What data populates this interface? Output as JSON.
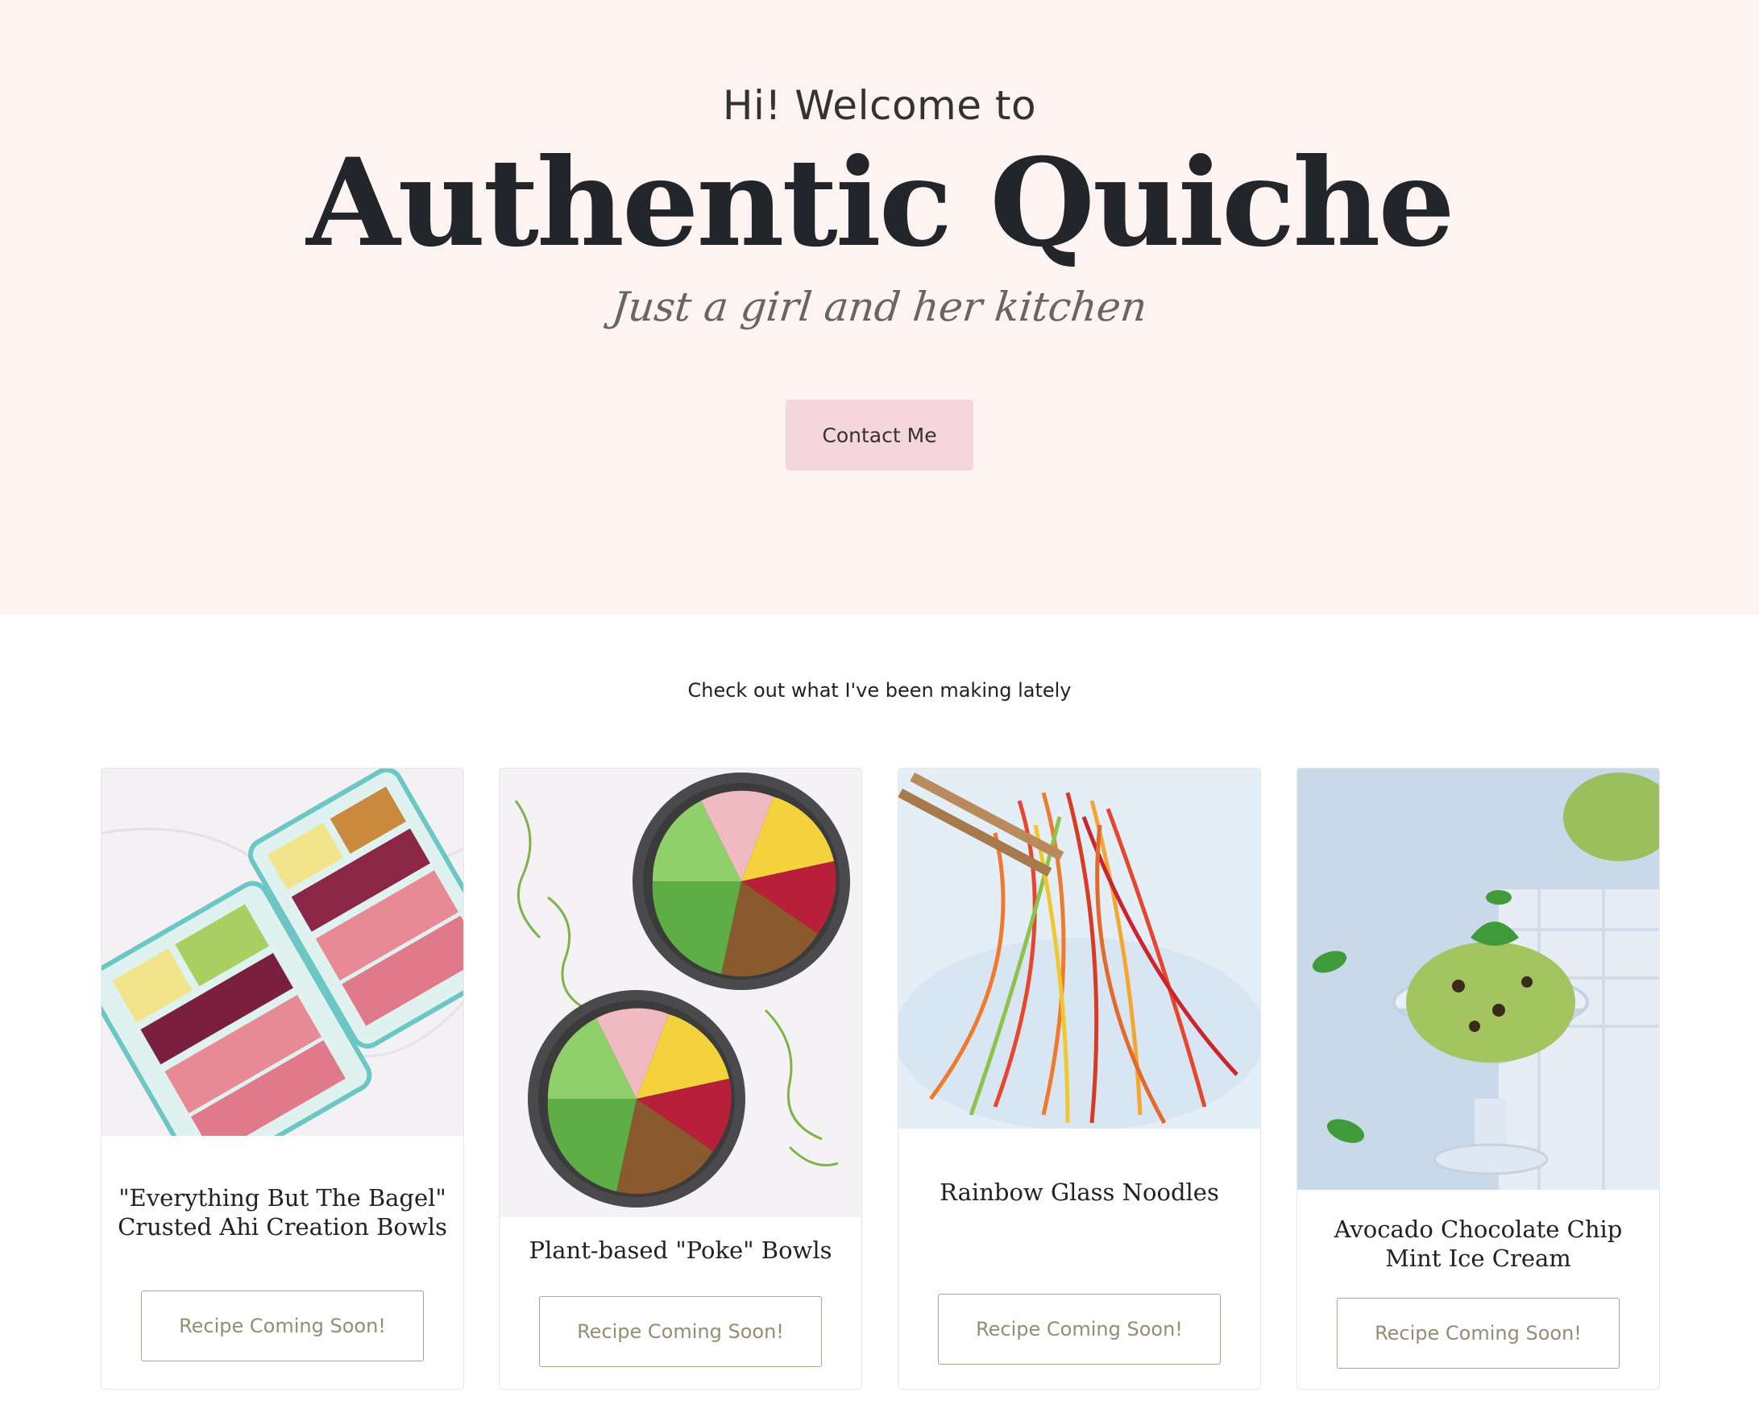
{
  "hero": {
    "welcome": "Hi! Welcome to",
    "title": "Authentic Quiche",
    "tagline": "Just a girl and her kitchen",
    "contact_button": "Contact Me"
  },
  "recent": {
    "subtitle": "Check out what I've been making lately",
    "cards": [
      {
        "title_line1": "\"Everything But The Bagel\"",
        "title_line2": "Crusted Ahi Creation Bowls",
        "button": "Recipe Coming Soon!",
        "image": "ahi-bowls-photo"
      },
      {
        "title_line1": "Plant-based \"Poke\" Bowls",
        "title_line2": "",
        "button": "Recipe Coming Soon!",
        "image": "poke-bowls-photo"
      },
      {
        "title_line1": "Rainbow Glass Noodles",
        "title_line2": "",
        "button": "Recipe Coming Soon!",
        "image": "glass-noodles-photo"
      },
      {
        "title_line1": "Avocado Chocolate Chip",
        "title_line2": "Mint Ice Cream",
        "button": "Recipe Coming Soon!",
        "image": "ice-cream-photo"
      }
    ]
  },
  "colors": {
    "hero_bg": "#fdf3f0",
    "contact_btn_bg": "#f5d6dc",
    "recipe_btn_border": "#a9a692",
    "recipe_btn_text": "#918e74"
  }
}
